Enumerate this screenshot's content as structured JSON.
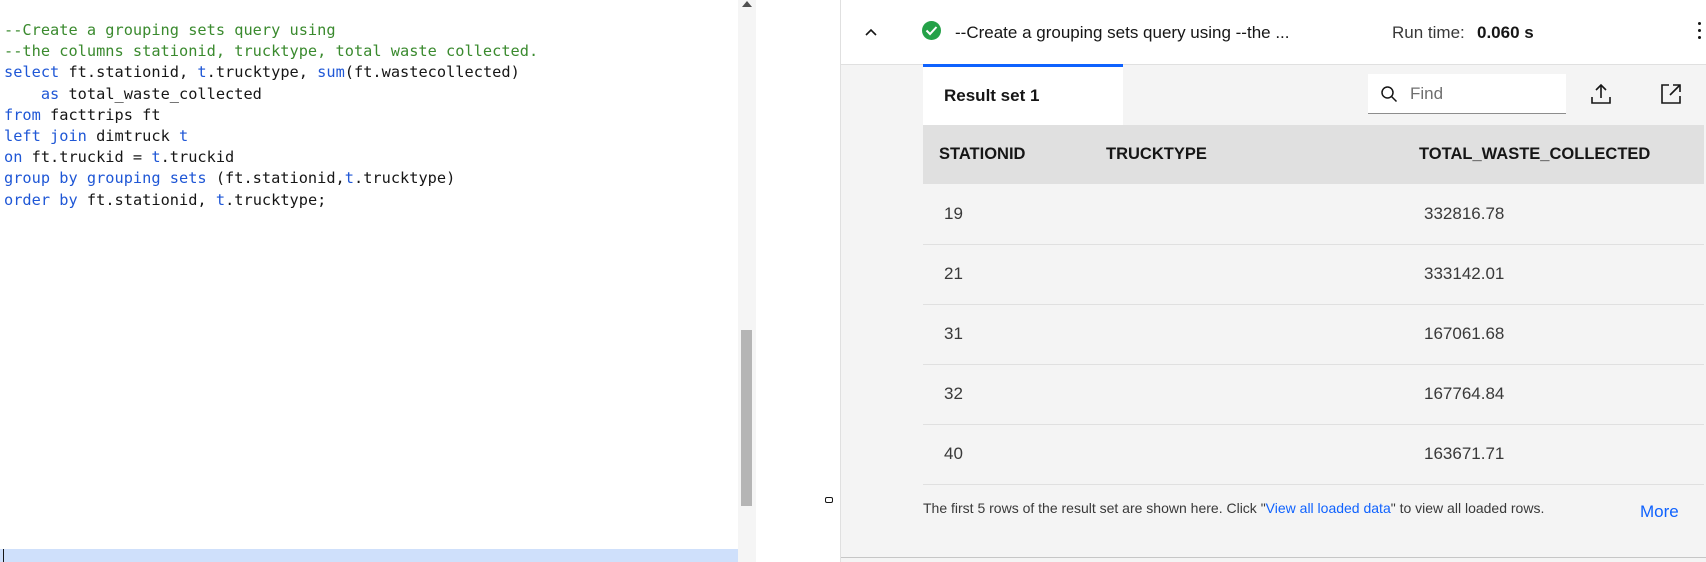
{
  "editor": {
    "lines": [
      {
        "parts": [
          {
            "t": "--Create a grouping sets query using",
            "c": "cmt"
          }
        ]
      },
      {
        "parts": [
          {
            "t": "--the columns stationid, trucktype, total waste collected.",
            "c": "cmt"
          }
        ]
      },
      {
        "parts": [
          {
            "t": "select",
            "c": "kw"
          },
          {
            "t": " ft.stationid, ",
            "c": ""
          },
          {
            "t": "t",
            "c": "kw"
          },
          {
            "t": ".trucktype, ",
            "c": ""
          },
          {
            "t": "sum",
            "c": "kw"
          },
          {
            "t": "(ft.wastecollected)",
            "c": ""
          }
        ]
      },
      {
        "parts": [
          {
            "t": "    ",
            "c": ""
          },
          {
            "t": "as",
            "c": "kw"
          },
          {
            "t": " total_waste_collected",
            "c": ""
          }
        ]
      },
      {
        "parts": [
          {
            "t": "from",
            "c": "kw"
          },
          {
            "t": " facttrips ft",
            "c": ""
          }
        ]
      },
      {
        "parts": [
          {
            "t": "left join",
            "c": "kw"
          },
          {
            "t": " dimtruck ",
            "c": ""
          },
          {
            "t": "t",
            "c": "kw"
          }
        ]
      },
      {
        "parts": [
          {
            "t": "on",
            "c": "kw"
          },
          {
            "t": " ft.truckid = ",
            "c": ""
          },
          {
            "t": "t",
            "c": "kw"
          },
          {
            "t": ".truckid",
            "c": ""
          }
        ]
      },
      {
        "parts": [
          {
            "t": "group by grouping sets",
            "c": "kw"
          },
          {
            "t": " (ft.stationid,",
            "c": ""
          },
          {
            "t": "t",
            "c": "kw"
          },
          {
            "t": ".trucktype)",
            "c": ""
          }
        ]
      },
      {
        "parts": [
          {
            "t": "order by",
            "c": "kw"
          },
          {
            "t": " ft.stationid, ",
            "c": ""
          },
          {
            "t": "t",
            "c": "kw"
          },
          {
            "t": ".trucktype;",
            "c": ""
          }
        ]
      }
    ]
  },
  "result_header": {
    "query_title": "--Create a grouping sets query using --the ...",
    "runtime_label": "Run time:",
    "runtime_value": "0.060 s",
    "status": "success"
  },
  "tabs": [
    {
      "label": "Result set 1",
      "active": true
    }
  ],
  "toolbar": {
    "find_placeholder": "Find",
    "find_value": "",
    "icons": [
      "search-icon",
      "export-icon",
      "popout-icon"
    ]
  },
  "table": {
    "columns": [
      "STATIONID",
      "TRUCKTYPE",
      "TOTAL_WASTE_COLLECTED"
    ],
    "rows": [
      [
        "19",
        "",
        "332816.78"
      ],
      [
        "21",
        "",
        "333142.01"
      ],
      [
        "31",
        "",
        "167061.68"
      ],
      [
        "32",
        "",
        "167764.84"
      ],
      [
        "40",
        "",
        "163671.71"
      ]
    ]
  },
  "footer": {
    "note_before": "The first 5 rows of the result set are shown here. Click \"",
    "link_text": "View all loaded data",
    "note_after": "\" to view all loaded rows.",
    "more_label": "More"
  },
  "colors": {
    "comment": "#3a8a2e",
    "keyword": "#1f57d6",
    "accent": "#0f62fe",
    "success": "#24a148"
  }
}
